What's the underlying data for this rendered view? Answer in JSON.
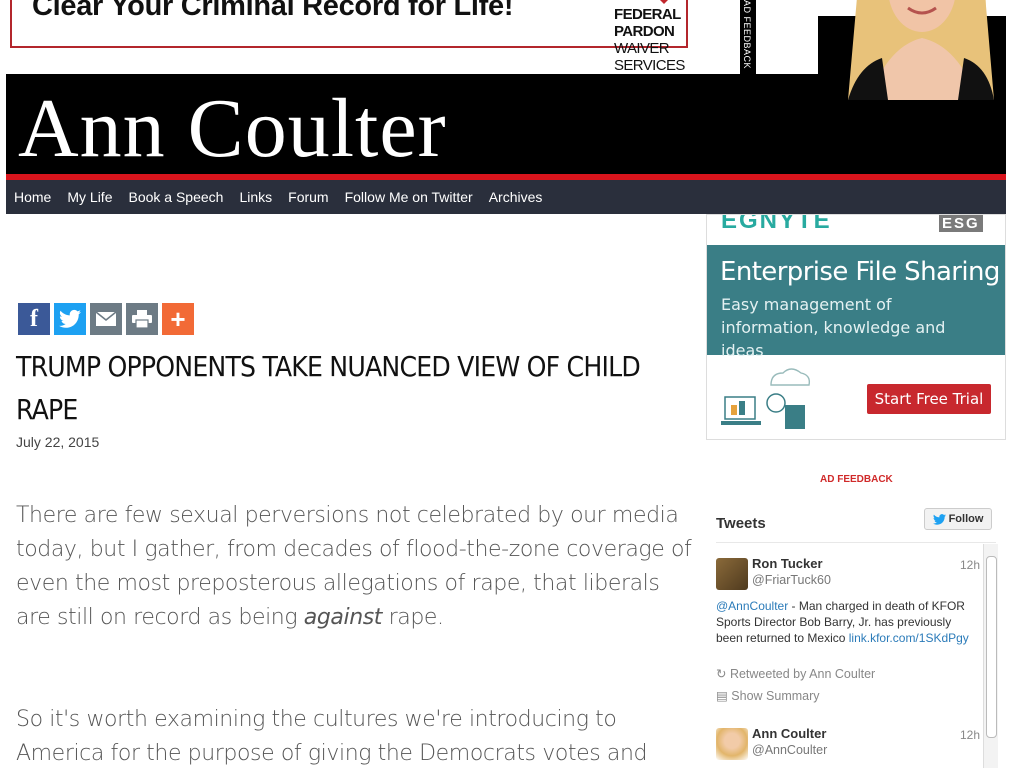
{
  "top_ad": {
    "headline": "Clear Your Criminal Record for Life!",
    "brand_line1": "FEDERAL PARDON",
    "brand_line2": "WAIVER SERVICES",
    "feedback": "AD FEEDBACK"
  },
  "header": {
    "site_title": "Ann Coulter"
  },
  "nav": {
    "items": [
      "Home",
      "My Life",
      "Book a Speech",
      "Links",
      "Forum",
      "Follow Me on Twitter",
      "Archives"
    ]
  },
  "share": {
    "icons": [
      "facebook-icon",
      "twitter-icon",
      "email-icon",
      "print-icon",
      "plus-icon"
    ]
  },
  "article": {
    "title": "TRUMP OPPONENTS TAKE NUANCED VIEW OF CHILD RAPE",
    "date": "July 22, 2015",
    "para1_a": "There are few sexual perversions not celebrated by our media today, but I gather, from decades of flood-the-zone coverage of even the most preposterous allegations of rape, that liberals are still on record as being ",
    "para1_em": "against",
    "para1_b": " rape.",
    "para2": "So it's worth examining the cultures we're introducing to America for the purpose of giving the Democrats votes and"
  },
  "side_ad": {
    "logo": "EGNYTE",
    "logo2": "ESG",
    "headline": "Enterprise File Sharing",
    "sub": "Easy management of information, knowledge and ideas",
    "cta": "Start Free Trial",
    "feedback": "AD FEEDBACK",
    "accent": "#3a7e86",
    "cta_color": "#c8282e"
  },
  "tweets": {
    "title": "Tweets",
    "follow_label": "Follow",
    "items": [
      {
        "name": "Ron Tucker",
        "handle": "@FriarTuck60",
        "time": "12h",
        "mention": "@AnnCoulter",
        "text": " - Man charged in death of KFOR Sports Director Bob Barry, Jr. has previously been returned to Mexico ",
        "link": "link.kfor.com/1SKdPgy",
        "retweeted": "Retweeted by Ann Coulter",
        "summary": "Show Summary"
      },
      {
        "name": "Ann Coulter",
        "handle": "@AnnCoulter",
        "time": "12h"
      }
    ]
  },
  "colors": {
    "nav_bg": "#2a2f3c",
    "header_bg": "#000000",
    "red_rule": "#d8141c"
  }
}
